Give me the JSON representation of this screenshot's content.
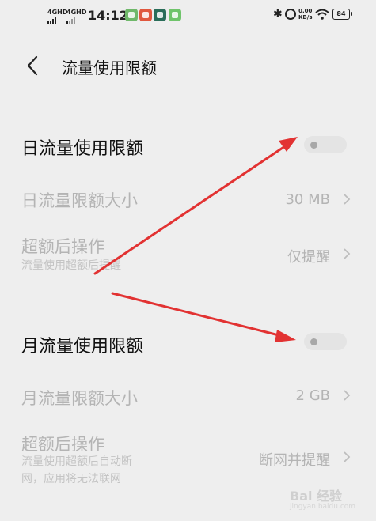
{
  "status_bar": {
    "sim1": "4GHD",
    "sim2": "4GHD",
    "time": "14:12",
    "net_speed_value": "0.00",
    "net_speed_unit": "KB/s",
    "battery": "84",
    "app_icon_colors": [
      "#6fb86a",
      "#e0573d",
      "#2a6d59",
      "#6fc46b"
    ]
  },
  "header": {
    "title": "流量使用限额"
  },
  "daily": {
    "title": "日流量使用限额",
    "toggle_on": false,
    "size_label": "日流量限额大小",
    "size_value": "30 MB",
    "action_label": "超额后操作",
    "action_desc": "流量使用超额后提醒",
    "action_value": "仅提醒"
  },
  "monthly": {
    "title": "月流量使用限额",
    "toggle_on": false,
    "size_label": "月流量限额大小",
    "size_value": "2 GB",
    "action_label": "超额后操作",
    "action_desc_line1": "流量使用超额后自动断",
    "action_desc_line2": "网，应用将无法联网",
    "action_value": "断网并提醒"
  },
  "watermark": {
    "text": "Bai 经验",
    "sub": "jingyan.baidu.com"
  },
  "colors": {
    "arrow": "#e23232",
    "toggle_track": "#e4e4e4",
    "toggle_knob": "#a8a8a8"
  }
}
